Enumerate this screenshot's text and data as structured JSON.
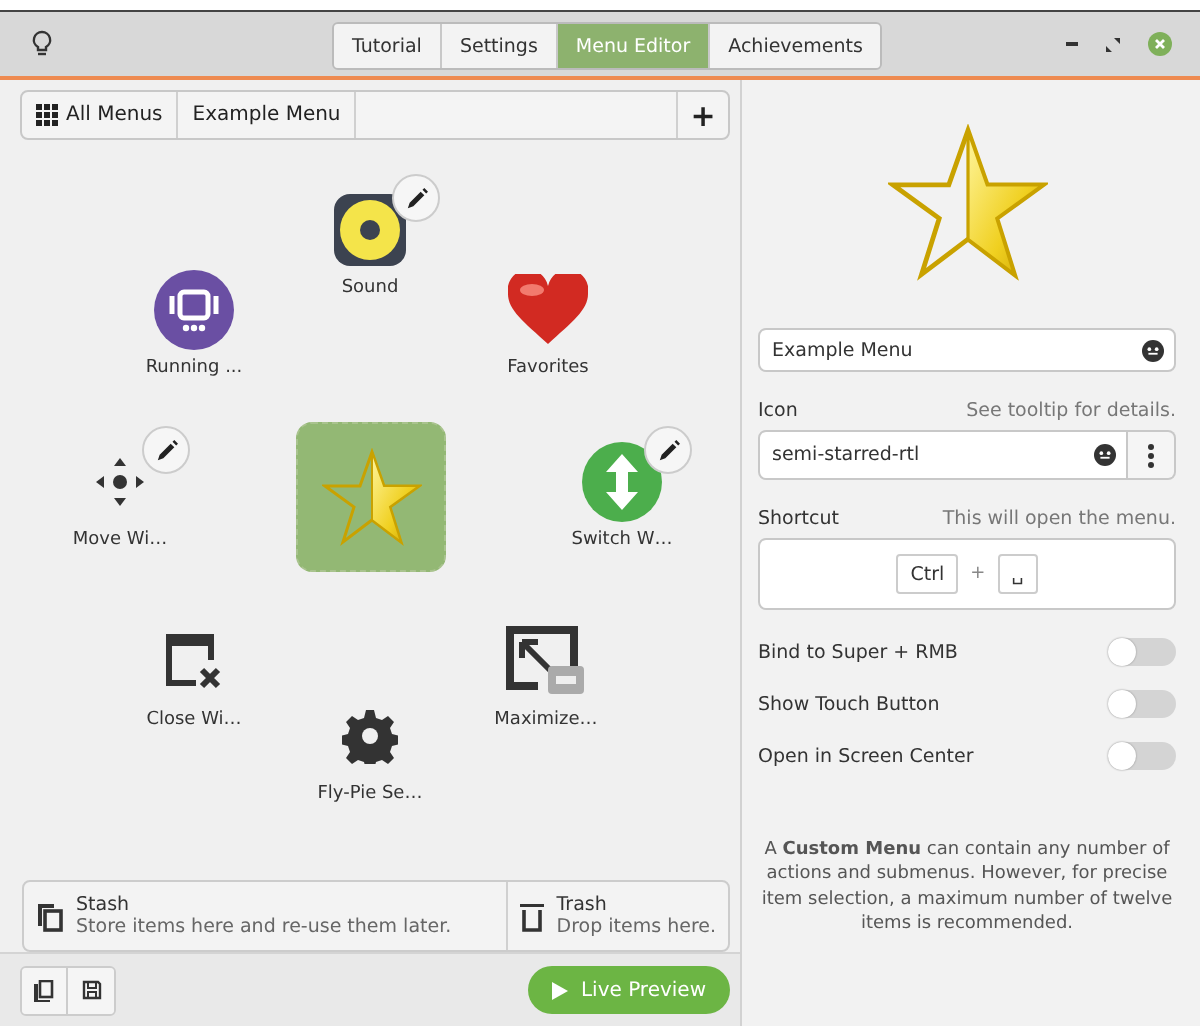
{
  "tabs": [
    {
      "label": "Tutorial",
      "selected": false
    },
    {
      "label": "Settings",
      "selected": false
    },
    {
      "label": "Menu Editor",
      "selected": true
    },
    {
      "label": "Achievements",
      "selected": false
    }
  ],
  "breadcrumb": {
    "all_menus": "All Menus",
    "items": [
      "Example Menu"
    ],
    "add": "+"
  },
  "menu_items": [
    {
      "label": "Sound",
      "editable": true
    },
    {
      "label": "Running ...",
      "editable": false
    },
    {
      "label": "Favorites",
      "editable": false
    },
    {
      "label": "Move Wi…",
      "editable": true
    },
    {
      "label": "Switch W…",
      "editable": true
    },
    {
      "label": "Close Wi…",
      "editable": false
    },
    {
      "label": "Maximize…",
      "editable": false
    },
    {
      "label": "Fly-Pie Se…",
      "editable": false
    }
  ],
  "stash": {
    "title": "Stash",
    "subtitle": "Store items here and re-use them later."
  },
  "trash": {
    "title": "Trash",
    "subtitle": "Drop items here."
  },
  "live_preview": "Live Preview",
  "name_field": {
    "value": "Example Menu"
  },
  "icon_field": {
    "label": "Icon",
    "hint": "See tooltip for details.",
    "value": "semi-starred-rtl"
  },
  "shortcut": {
    "label": "Shortcut",
    "hint": "This will open the menu.",
    "keys": [
      "Ctrl",
      "␣"
    ],
    "separator": "+"
  },
  "toggles": [
    {
      "label": "Bind to Super + RMB",
      "on": false
    },
    {
      "label": "Show Touch Button",
      "on": false
    },
    {
      "label": "Open in Screen Center",
      "on": false
    }
  ],
  "info": "A **Custom Menu** can contain any number of actions and submenus. However, for precise item selection, a maximum number of twelve items is recommended."
}
